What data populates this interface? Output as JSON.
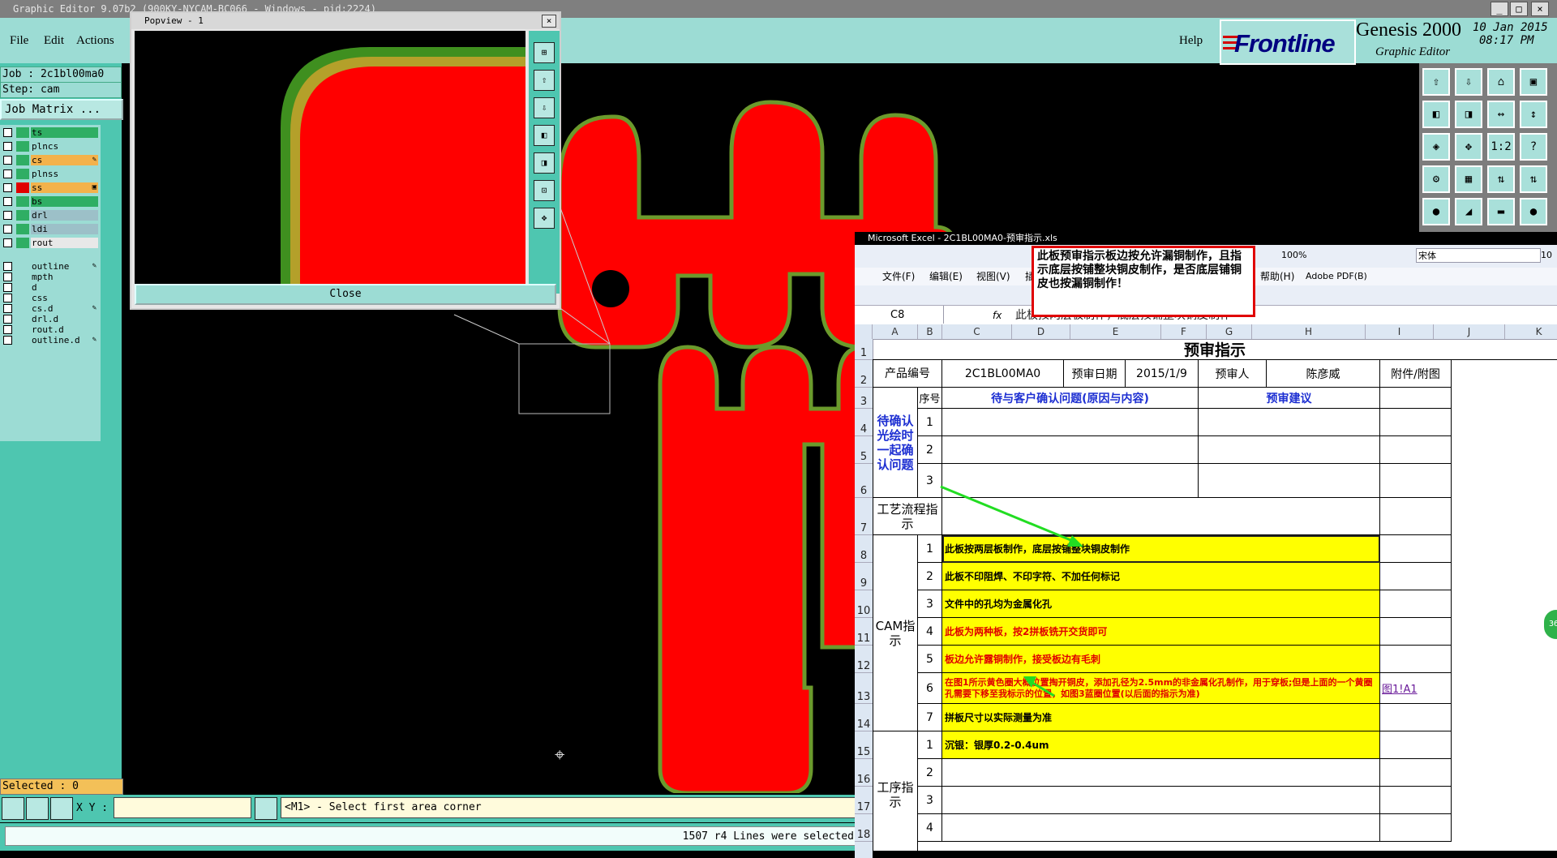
{
  "genesis": {
    "window_title": "Graphic Editor 9.07b2 (900KY-NYCAM-BC066 - Windows - pid:2224)",
    "menus": [
      "File",
      "Edit",
      "Actions"
    ],
    "help": "Help",
    "brand": "Frontline",
    "product": "Genesis 2000",
    "product_sub": "Graphic Editor",
    "date_line1": "10 Jan 2015",
    "date_line2": "08:17 PM",
    "job": "Job : 2c1bl00ma0",
    "step": "Step: cam",
    "job_matrix": "Job Matrix ...",
    "layers": [
      {
        "name": "ts",
        "color": "#2fae64",
        "bg": "#2fae64",
        "flag": ""
      },
      {
        "name": "plncs",
        "color": "#2fae64",
        "bg": "#9cdcd4",
        "flag": ""
      },
      {
        "name": "cs",
        "color": "#2fae64",
        "bg": "#f3b24b",
        "flag": "✎"
      },
      {
        "name": "plnss",
        "color": "#2fae64",
        "bg": "#9cdcd4",
        "flag": ""
      },
      {
        "name": "ss",
        "color": "#e00000",
        "bg": "#f3b24b",
        "flag": "▣"
      },
      {
        "name": "bs",
        "color": "#2fae64",
        "bg": "#2fae64",
        "flag": ""
      },
      {
        "name": "drl",
        "color": "#2fae64",
        "bg": "#9cc0c8",
        "flag": ""
      },
      {
        "name": "ldi",
        "color": "#2fae64",
        "bg": "#9cc0c8",
        "flag": ""
      },
      {
        "name": "rout",
        "color": "#2fae64",
        "bg": "#e8e8e8",
        "flag": ""
      },
      {
        "name": "outline",
        "color": "#9cdcd4",
        "bg": "#9cdcd4",
        "flag": "✎"
      },
      {
        "name": "mpth",
        "color": "#9cdcd4",
        "bg": "#9cdcd4",
        "flag": ""
      },
      {
        "name": "d",
        "color": "#9cdcd4",
        "bg": "#9cdcd4",
        "flag": ""
      },
      {
        "name": "css",
        "color": "#9cdcd4",
        "bg": "#9cdcd4",
        "flag": ""
      },
      {
        "name": "cs.d",
        "color": "#9cdcd4",
        "bg": "#9cdcd4",
        "flag": "✎"
      },
      {
        "name": "drl.d",
        "color": "#9cdcd4",
        "bg": "#9cdcd4",
        "flag": ""
      },
      {
        "name": "rout.d",
        "color": "#9cdcd4",
        "bg": "#9cdcd4",
        "flag": ""
      },
      {
        "name": "outline.d",
        "color": "#9cdcd4",
        "bg": "#9cdcd4",
        "flag": "✎"
      }
    ],
    "selected": "Selected : 0",
    "xy_label": "X Y :",
    "xy_value": "",
    "message": "<M1> - Select first area corner",
    "status": "1507 r4 Lines were selected",
    "right_buttons": [
      "⇧",
      "⇩",
      "⌂",
      "▣",
      "◧",
      "◨",
      "↔",
      "↕",
      "◈",
      "✥",
      "1:2",
      "?",
      "⚙",
      "▦",
      "⇅",
      "⇅",
      "●",
      "◢",
      "▬",
      "●"
    ]
  },
  "popview": {
    "title": "Popview - 1",
    "close_label": "Close",
    "side_buttons": [
      "⊞",
      "⇧",
      "⇩",
      "◧",
      "◨",
      "⊡",
      "✥"
    ]
  },
  "excel": {
    "window_title": "Microsoft Excel - 2C1BL00MA0-预审指示.xls",
    "menu": [
      "文件(F)",
      "编辑(E)",
      "视图(V)",
      "插",
      "帮助(H)",
      "Adobe PDF(B)"
    ],
    "zoom": "100%",
    "font": "宋体",
    "font_size": "10",
    "name_box": "C8",
    "fx": "fx",
    "formula": "此板按两层板制作，底层按铺整块铜皮制作",
    "columns": [
      "A",
      "B",
      "C",
      "D",
      "E",
      "F",
      "G",
      "H",
      "I",
      "J",
      "K"
    ],
    "rows": [
      "1",
      "2",
      "3",
      "4",
      "5",
      "6",
      "7",
      "8",
      "9",
      "10",
      "11",
      "12",
      "13",
      "14",
      "15",
      "16",
      "17",
      "18"
    ],
    "title": "预审指示",
    "product_label": "产品编号",
    "product_no": "2C1BL00MA0",
    "review_date_label": "预审日期",
    "review_date": "2015/1/9",
    "reviewer_label": "预审人",
    "reviewer": "陈彦威",
    "attach_label": "附件/附图",
    "seq_label": "序号",
    "confirm_header": "待与客户确认问题(原因与内容)",
    "suggest_header": "预审建议",
    "pending_label": "待确认光绘时一起确认问题",
    "process_label": "工艺流程指示",
    "cam_label": "CAM指示",
    "procedure_label": "工序指示",
    "n1": "1",
    "n2": "2",
    "n3": "3",
    "n4": "4",
    "n5": "5",
    "n6": "6",
    "n7": "7",
    "cam_items": [
      "此板按两层板制作，底层按铺整块铜皮制作",
      "此板不印阻焊、不印字符、不加任何标记",
      "文件中的孔均为金属化孔",
      "此板为两种板，按2拼板铣开交货即可",
      "板边允许露铜制作，接受板边有毛刺",
      "在图1所示黄色圈大概位置掏开铜皮，添加孔径为2.5mm的非金属化孔制作，用于穿板;但是上面的一个黄圈孔需要下移至我标示的位置，如图3蓝圈位置(以后面的指示为准)",
      "拼板尺寸以实际测量为准"
    ],
    "link": "图1!A1",
    "proc_item1": "沉银：银厚0.2-0.4um"
  },
  "callout": {
    "text": "此板预审指示板边按允许漏铜制作，且指示底层按铺整块铜皮制作，是否底层铺铜皮也按漏铜制作！"
  },
  "badge": "36"
}
